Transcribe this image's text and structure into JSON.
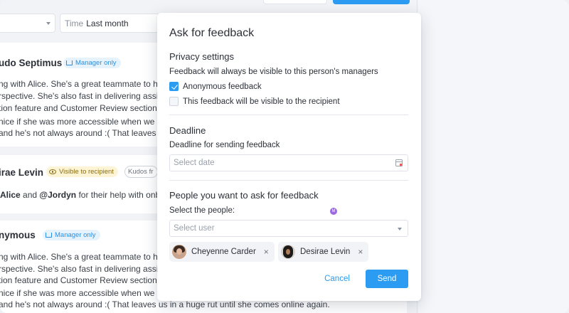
{
  "filters": {
    "first_value": "",
    "time_key": "Time",
    "time_value": "Last month"
  },
  "feed": {
    "card1": {
      "name": "udo Septimus",
      "badge": "Manager only",
      "lines": [
        "ng with Alice. She's a great teammate to ha",
        "rspective. She's also fast in delivering assig",
        "tion feature and Customer Review section f",
        "nice if she was more accessible when we h",
        "and he's not always around :( That leaves u"
      ]
    },
    "card2": {
      "name": "irae Levin",
      "badge": "Visible to recipient",
      "badge2": "Kudos fr",
      "line_mention1": "Alice",
      "line_and": " and ",
      "line_mention2": "@Jordyn",
      "line_rest": " for their help with onbo"
    },
    "card3": {
      "name": "nymous",
      "badge": "Manager only",
      "lines": [
        "ng with Alice. She's a great teammate to ha",
        "rspective. She's also fast in delivering assig",
        "tion feature and Customer Review section f",
        "nice if she was more accessible when we h",
        "and he's not always around :( That leaves us in a huge rut until she comes online again."
      ]
    }
  },
  "modal": {
    "title": "Ask for feedback",
    "privacy": {
      "heading": "Privacy settings",
      "note": "Feedback will always be visible to this person's managers",
      "option1": {
        "label": "Anonymous feedback",
        "checked": true
      },
      "option2": {
        "label": "This feedback will be visible to the recipient",
        "checked": false
      }
    },
    "deadline": {
      "heading": "Deadline",
      "label": "Deadline for sending feedback",
      "placeholder": "Select date"
    },
    "people": {
      "heading": "People you want to ask for feedback",
      "label": "Select the people:",
      "placeholder": "Select user",
      "cursor_badge": "M",
      "selected": [
        {
          "name": "Cheyenne Carder",
          "avatar": "avatar-cheyenne"
        },
        {
          "name": "Desirae Levin",
          "avatar": "avatar-desirae"
        }
      ],
      "remove_glyph": "×"
    },
    "actions": {
      "cancel": "Cancel",
      "send": "Send"
    }
  },
  "colors": {
    "accent": "#2b9cf1",
    "badge_blue_bg": "#e6f3fd",
    "badge_yellow_bg": "#fdf4d5"
  }
}
